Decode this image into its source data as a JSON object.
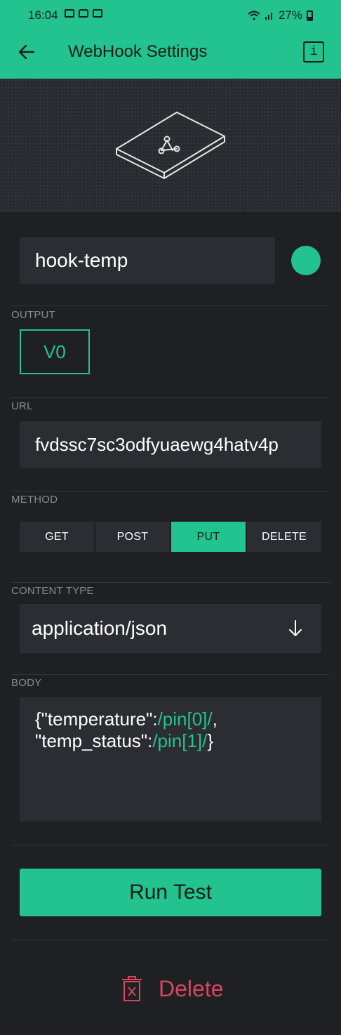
{
  "status_bar": {
    "time": "16:04",
    "battery": "27%",
    "icons": [
      "gallery-icon",
      "message-icon",
      "voicemail-icon",
      "wifi-icon",
      "signal-icon",
      "battery-icon"
    ]
  },
  "app_bar": {
    "title": "WebHook Settings",
    "back_icon": "arrow-left-icon",
    "info_label": "i"
  },
  "colors": {
    "accent": "#22c38e",
    "background": "#1f2024",
    "field": "#2c2d33",
    "danger": "#d9455e"
  },
  "form": {
    "name_value": "hook-temp",
    "output": {
      "label": "OUTPUT",
      "pin": "V0"
    },
    "url": {
      "label": "URL",
      "value": "fvdssc7sc3odfyuaewg4hatv4p"
    },
    "method": {
      "label": "METHOD",
      "options": [
        "GET",
        "POST",
        "PUT",
        "DELETE"
      ],
      "selected": "PUT"
    },
    "content_type": {
      "label": "CONTENT TYPE",
      "value": "application/json"
    },
    "body": {
      "label": "BODY",
      "line1_key": "{\"temperature\":",
      "line1_pin": "/pin[0]/",
      "line1_end": ",",
      "line2_key": "\"temp_status\":",
      "line2_pin": "/pin[1]/",
      "line2_end": "}"
    }
  },
  "actions": {
    "run_test": "Run Test",
    "delete": "Delete"
  }
}
